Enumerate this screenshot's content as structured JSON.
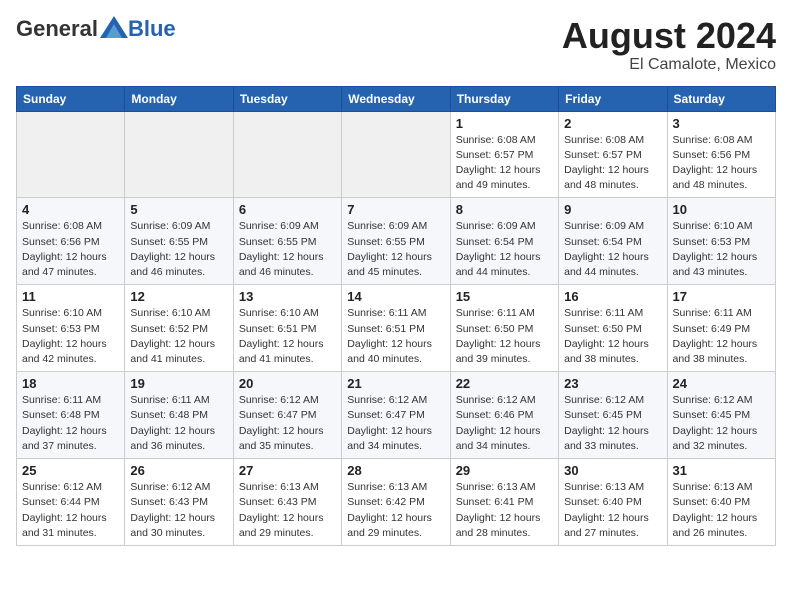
{
  "logo": {
    "general": "General",
    "blue": "Blue"
  },
  "title": {
    "month_year": "August 2024",
    "location": "El Camalote, Mexico"
  },
  "weekdays": [
    "Sunday",
    "Monday",
    "Tuesday",
    "Wednesday",
    "Thursday",
    "Friday",
    "Saturday"
  ],
  "weeks": [
    [
      {
        "day": "",
        "info": ""
      },
      {
        "day": "",
        "info": ""
      },
      {
        "day": "",
        "info": ""
      },
      {
        "day": "",
        "info": ""
      },
      {
        "day": "1",
        "info": "Sunrise: 6:08 AM\nSunset: 6:57 PM\nDaylight: 12 hours\nand 49 minutes."
      },
      {
        "day": "2",
        "info": "Sunrise: 6:08 AM\nSunset: 6:57 PM\nDaylight: 12 hours\nand 48 minutes."
      },
      {
        "day": "3",
        "info": "Sunrise: 6:08 AM\nSunset: 6:56 PM\nDaylight: 12 hours\nand 48 minutes."
      }
    ],
    [
      {
        "day": "4",
        "info": "Sunrise: 6:08 AM\nSunset: 6:56 PM\nDaylight: 12 hours\nand 47 minutes."
      },
      {
        "day": "5",
        "info": "Sunrise: 6:09 AM\nSunset: 6:55 PM\nDaylight: 12 hours\nand 46 minutes."
      },
      {
        "day": "6",
        "info": "Sunrise: 6:09 AM\nSunset: 6:55 PM\nDaylight: 12 hours\nand 46 minutes."
      },
      {
        "day": "7",
        "info": "Sunrise: 6:09 AM\nSunset: 6:55 PM\nDaylight: 12 hours\nand 45 minutes."
      },
      {
        "day": "8",
        "info": "Sunrise: 6:09 AM\nSunset: 6:54 PM\nDaylight: 12 hours\nand 44 minutes."
      },
      {
        "day": "9",
        "info": "Sunrise: 6:09 AM\nSunset: 6:54 PM\nDaylight: 12 hours\nand 44 minutes."
      },
      {
        "day": "10",
        "info": "Sunrise: 6:10 AM\nSunset: 6:53 PM\nDaylight: 12 hours\nand 43 minutes."
      }
    ],
    [
      {
        "day": "11",
        "info": "Sunrise: 6:10 AM\nSunset: 6:53 PM\nDaylight: 12 hours\nand 42 minutes."
      },
      {
        "day": "12",
        "info": "Sunrise: 6:10 AM\nSunset: 6:52 PM\nDaylight: 12 hours\nand 41 minutes."
      },
      {
        "day": "13",
        "info": "Sunrise: 6:10 AM\nSunset: 6:51 PM\nDaylight: 12 hours\nand 41 minutes."
      },
      {
        "day": "14",
        "info": "Sunrise: 6:11 AM\nSunset: 6:51 PM\nDaylight: 12 hours\nand 40 minutes."
      },
      {
        "day": "15",
        "info": "Sunrise: 6:11 AM\nSunset: 6:50 PM\nDaylight: 12 hours\nand 39 minutes."
      },
      {
        "day": "16",
        "info": "Sunrise: 6:11 AM\nSunset: 6:50 PM\nDaylight: 12 hours\nand 38 minutes."
      },
      {
        "day": "17",
        "info": "Sunrise: 6:11 AM\nSunset: 6:49 PM\nDaylight: 12 hours\nand 38 minutes."
      }
    ],
    [
      {
        "day": "18",
        "info": "Sunrise: 6:11 AM\nSunset: 6:48 PM\nDaylight: 12 hours\nand 37 minutes."
      },
      {
        "day": "19",
        "info": "Sunrise: 6:11 AM\nSunset: 6:48 PM\nDaylight: 12 hours\nand 36 minutes."
      },
      {
        "day": "20",
        "info": "Sunrise: 6:12 AM\nSunset: 6:47 PM\nDaylight: 12 hours\nand 35 minutes."
      },
      {
        "day": "21",
        "info": "Sunrise: 6:12 AM\nSunset: 6:47 PM\nDaylight: 12 hours\nand 34 minutes."
      },
      {
        "day": "22",
        "info": "Sunrise: 6:12 AM\nSunset: 6:46 PM\nDaylight: 12 hours\nand 34 minutes."
      },
      {
        "day": "23",
        "info": "Sunrise: 6:12 AM\nSunset: 6:45 PM\nDaylight: 12 hours\nand 33 minutes."
      },
      {
        "day": "24",
        "info": "Sunrise: 6:12 AM\nSunset: 6:45 PM\nDaylight: 12 hours\nand 32 minutes."
      }
    ],
    [
      {
        "day": "25",
        "info": "Sunrise: 6:12 AM\nSunset: 6:44 PM\nDaylight: 12 hours\nand 31 minutes."
      },
      {
        "day": "26",
        "info": "Sunrise: 6:12 AM\nSunset: 6:43 PM\nDaylight: 12 hours\nand 30 minutes."
      },
      {
        "day": "27",
        "info": "Sunrise: 6:13 AM\nSunset: 6:43 PM\nDaylight: 12 hours\nand 29 minutes."
      },
      {
        "day": "28",
        "info": "Sunrise: 6:13 AM\nSunset: 6:42 PM\nDaylight: 12 hours\nand 29 minutes."
      },
      {
        "day": "29",
        "info": "Sunrise: 6:13 AM\nSunset: 6:41 PM\nDaylight: 12 hours\nand 28 minutes."
      },
      {
        "day": "30",
        "info": "Sunrise: 6:13 AM\nSunset: 6:40 PM\nDaylight: 12 hours\nand 27 minutes."
      },
      {
        "day": "31",
        "info": "Sunrise: 6:13 AM\nSunset: 6:40 PM\nDaylight: 12 hours\nand 26 minutes."
      }
    ]
  ]
}
